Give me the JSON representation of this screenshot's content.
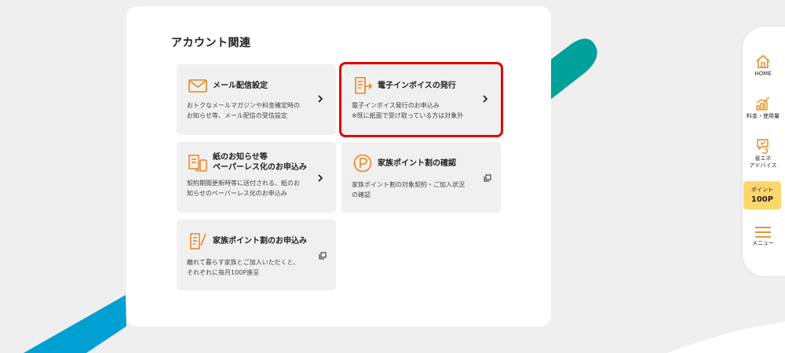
{
  "section": {
    "title": "アカウント関連"
  },
  "tiles": [
    {
      "title": "メール配信設定",
      "desc": [
        "おトクなメールマガジンや料金確定時の",
        "お知らせ等、メール配信の受信設定"
      ],
      "icon": "mail-icon",
      "action": "chevron"
    },
    {
      "title": "電子インボイスの発行",
      "desc": [
        "電子インボイス発行のお申込み",
        "※既に紙面で受け取っている方は対象外"
      ],
      "icon": "invoice-icon",
      "action": "chevron"
    },
    {
      "title": [
        "紙のお知らせ等",
        "ペーパーレス化のお申込み"
      ],
      "desc": [
        "契約期間更新時等に送付される、紙のお",
        "知らせのペーパーレス化のお申込み"
      ],
      "icon": "paperless-icon",
      "action": "chevron"
    },
    {
      "title": "家族ポイント割の確認",
      "desc": [
        "家族ポイント割の対象契約・ご加入状況",
        "の確認"
      ],
      "icon": "point-icon",
      "action": "external"
    },
    {
      "title": "家族ポイント割のお申込み",
      "desc": [
        "離れて暮らす家族とご加入いただくと、",
        "それぞれに毎月100P進呈"
      ],
      "icon": "application-icon",
      "action": "external"
    }
  ],
  "sidebar": {
    "home": "HOME",
    "usage": "料金・使用量",
    "advice": "省エネ\nアドバイス",
    "points_label": "ポイント",
    "points_value": "100P",
    "menu": "メニュー"
  },
  "colors": {
    "accent_orange": "#e8851e",
    "teal": "#00a19a",
    "blue": "#00a0d2",
    "points_yellow": "#ffd66b",
    "highlight_red": "#e00000"
  }
}
